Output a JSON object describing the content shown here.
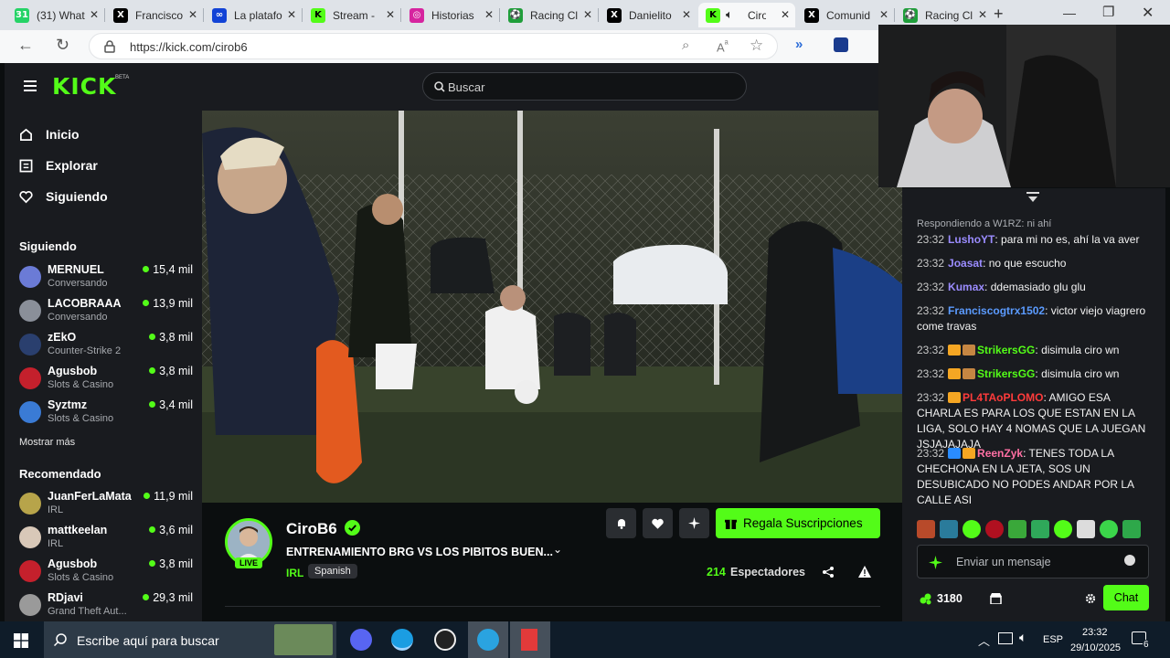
{
  "browser": {
    "tabs": [
      {
        "label": "(31) What",
        "icon": "whatsapp-icon",
        "color": "#25d366",
        "glyph": "31"
      },
      {
        "label": "Francisco",
        "icon": "x-icon",
        "color": "#000000",
        "glyph": "X"
      },
      {
        "label": "La platafo",
        "icon": "meta-icon",
        "color": "#1243d6",
        "glyph": "∞"
      },
      {
        "label": "Stream - ",
        "icon": "kick-icon",
        "color": "#53fc18",
        "glyph": "K"
      },
      {
        "label": "Historias",
        "icon": "instagram-icon",
        "color": "#d6249f",
        "glyph": "◎"
      },
      {
        "label": "Racing Cl",
        "icon": "soccer-icon",
        "color": "#1f9e3a",
        "glyph": "⚽"
      },
      {
        "label": "Danielito",
        "icon": "x-icon",
        "color": "#000000",
        "glyph": "X"
      },
      {
        "label": "Ciro",
        "icon": "kick-icon",
        "color": "#53fc18",
        "glyph": "K"
      },
      {
        "label": "Comunid",
        "icon": "x-icon",
        "color": "#000000",
        "glyph": "X"
      },
      {
        "label": "Racing Cl",
        "icon": "soccer-icon",
        "color": "#1f9e3a",
        "glyph": "⚽"
      }
    ],
    "url": "https://kick.com/cirob6"
  },
  "kick": {
    "logo": "KICK",
    "logo_sup": "BETA",
    "search_placeholder": "Buscar",
    "nav": [
      "Inicio",
      "Explorar",
      "Siguiendo"
    ],
    "following_title": "Siguiendo",
    "following": [
      {
        "name": "MERNUEL",
        "category": "Conversando",
        "viewers": "15,4 mil",
        "color": "#6b7bd6"
      },
      {
        "name": "LACOBRAAA",
        "category": "Conversando",
        "viewers": "13,9 mil",
        "color": "#8a8f99"
      },
      {
        "name": "zEkO",
        "category": "Counter-Strike 2",
        "viewers": "3,8 mil",
        "color": "#2a3f6e"
      },
      {
        "name": "Agusbob",
        "category": "Slots & Casino",
        "viewers": "3,8 mil",
        "color": "#c4202c"
      },
      {
        "name": "Syztmz",
        "category": "Slots & Casino",
        "viewers": "3,4 mil",
        "color": "#3a7bd5"
      }
    ],
    "show_more": "Mostrar más",
    "recommended_title": "Recomendado",
    "recommended": [
      {
        "name": "JuanFerLaMata",
        "category": "IRL",
        "viewers": "11,9 mil",
        "color": "#b7a44a"
      },
      {
        "name": "mattkeelan",
        "category": "IRL",
        "viewers": "3,6 mil",
        "color": "#d8c8b8"
      },
      {
        "name": "Agusbob",
        "category": "Slots & Casino",
        "viewers": "3,8 mil",
        "color": "#c4202c"
      },
      {
        "name": "RDjavi",
        "category": "Grand Theft Aut...",
        "viewers": "29,3 mil",
        "color": "#9a9a9a"
      }
    ],
    "streamer": {
      "name": "CiroB6",
      "live_badge": "LIVE",
      "title": "ENTRENAMIENTO BRG VS LOS PIBITOS BUEN...",
      "category": "IRL",
      "language": "Spanish",
      "viewers": "214",
      "viewers_label": "Espectadores",
      "gift_button": "Regala Suscripciones"
    },
    "chat": {
      "replying": "Respondiendo a W1RZ: ni ahí",
      "messages": [
        {
          "time": "23:32",
          "user": "LushoYT",
          "color": "#9b8cff",
          "badges": [],
          "text": "para mi no es, ahí la va aver"
        },
        {
          "time": "23:32",
          "user": "Joasat",
          "color": "#9b8cff",
          "badges": [],
          "text": "no que escucho"
        },
        {
          "time": "23:32",
          "user": "Kumax",
          "color": "#9b8cff",
          "badges": [],
          "text": "ddemasiado glu glu"
        },
        {
          "time": "23:32",
          "user": "Franciscogtrx1502",
          "color": "#5b9bff",
          "badges": [],
          "text": "victor viejo viagrero come travas"
        },
        {
          "time": "23:32",
          "user": "StrikersGG",
          "color": "#53fc18",
          "badges": [
            "#f5a623",
            "#c68642"
          ],
          "text": "disimula ciro wn"
        },
        {
          "time": "23:32",
          "user": "StrikersGG",
          "color": "#53fc18",
          "badges": [
            "#f5a623",
            "#c68642"
          ],
          "text": "disimula ciro wn"
        },
        {
          "time": "23:32",
          "user": "PL4TAoPLOMO",
          "color": "#ff3b3b",
          "badges": [
            "#f5a623"
          ],
          "text": "AMIGO ESA CHARLA ES PARA LOS QUE ESTAN EN LA LIGA, SOLO HAY 4 NOMAS QUE LA JUEGAN JSJAJAJAJA"
        },
        {
          "time": "23:32",
          "user": "ReenZyk",
          "color": "#ff6fa3",
          "badges": [
            "#2a8cff",
            "#f5a623"
          ],
          "text": "TENES TODA LA CHECHONA EN LA JETA, SOS UN DESUBICADO NO PODES ANDAR POR LA CALLE ASI"
        }
      ],
      "input_placeholder": "Enviar un mensaje",
      "points": "3180",
      "chat_button": "Chat"
    }
  },
  "taskbar": {
    "search_placeholder": "Escribe aquí para buscar",
    "lang": "ESP",
    "time": "23:32",
    "date": "29/10/2025",
    "notif_count": "6"
  }
}
